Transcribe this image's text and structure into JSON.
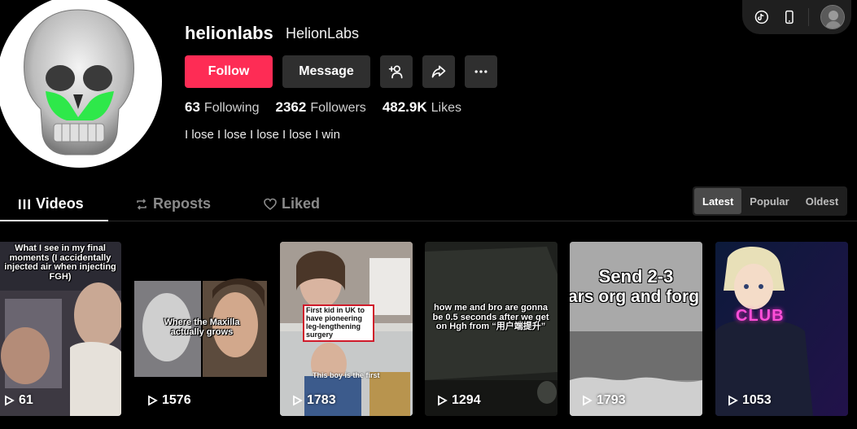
{
  "profile": {
    "username": "helionlabs",
    "nickname": "HelionLabs",
    "bio": "I lose I lose I lose I lose I win",
    "avatar_icon": "skull-icon"
  },
  "actions": {
    "follow_label": "Follow",
    "message_label": "Message",
    "add_friend_icon": "add-friend-icon",
    "share_icon": "share-icon",
    "more_icon": "more-icon"
  },
  "stats": [
    {
      "value": "63",
      "label": "Following"
    },
    {
      "value": "2362",
      "label": "Followers"
    },
    {
      "value": "482.9K",
      "label": "Likes"
    }
  ],
  "tabs": [
    {
      "label": "Videos",
      "icon": "grid-icon",
      "active": true
    },
    {
      "label": "Reposts",
      "icon": "repost-icon",
      "active": false
    },
    {
      "label": "Liked",
      "icon": "heart-icon",
      "active": false
    }
  ],
  "sort": {
    "options": [
      "Latest",
      "Popular",
      "Oldest"
    ],
    "selected": "Latest"
  },
  "videos": [
    {
      "caption": "What I see in my final moments (I accidentally injected air when injecting FGH)",
      "views": "61"
    },
    {
      "caption": "Where the Maxilla actually grows",
      "views": "1576"
    },
    {
      "caption": "First kid in UK to have pioneering leg-lengthening surgery",
      "caption2": "This boy is the first",
      "views": "1783"
    },
    {
      "caption": "how me and bro are gonna be 0.5 seconds after we get on Hgh from “用户端提升”",
      "views": "1294"
    },
    {
      "caption": "Send 2-3",
      "caption2": "ars org and forg",
      "views": "1793"
    },
    {
      "caption": "CLUB",
      "views": "1053"
    }
  ],
  "colors": {
    "accent": "#fe2c55",
    "background": "#000000",
    "button_dark": "#2f2f2f",
    "skull_highlight": "#2ee84a"
  }
}
